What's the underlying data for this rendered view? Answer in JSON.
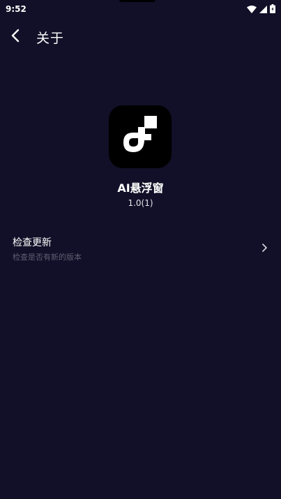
{
  "status_bar": {
    "time": "9:52",
    "icons": [
      "wifi-icon",
      "signal-icon",
      "battery-icon"
    ]
  },
  "app_bar": {
    "title": "关于",
    "back_icon": "back-arrow-icon"
  },
  "app_info": {
    "name": "AI悬浮窗",
    "version": "1.0(1)",
    "logo_icon": "app-logo-icon"
  },
  "settings": {
    "check_update": {
      "title": "检查更新",
      "subtitle": "检查是否有新的版本",
      "icon": "chevron-right-icon"
    }
  },
  "colors": {
    "background": "#111028",
    "text_primary": "#ffffff",
    "text_secondary": "#5d5d72",
    "logo_background": "#000000"
  }
}
